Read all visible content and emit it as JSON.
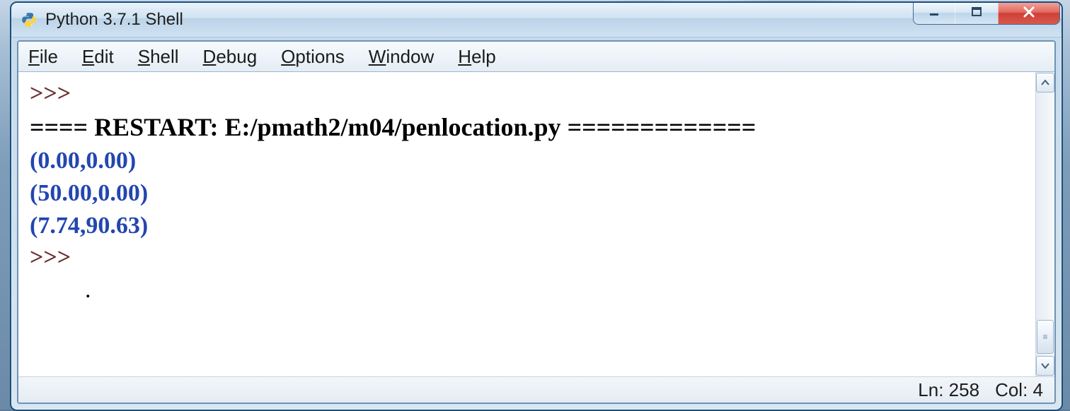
{
  "window": {
    "title": "Python 3.7.1 Shell"
  },
  "menu": {
    "file": "File",
    "edit": "Edit",
    "shell": "Shell",
    "debug": "Debug",
    "options": "Options",
    "window": "Window",
    "help": "Help"
  },
  "shell": {
    "prompt": ">>>",
    "restart_prefix": "====",
    "restart_label": " RESTART: ",
    "restart_path": "E:/pmath2/m04/penlocation.py ",
    "restart_suffix": "=============",
    "output": [
      "(0.00,0.00)",
      "(50.00,0.00)",
      "(7.74,90.63)"
    ]
  },
  "status": {
    "line_label": "Ln: ",
    "line_value": "258",
    "col_label": "Col: ",
    "col_value": "4"
  }
}
